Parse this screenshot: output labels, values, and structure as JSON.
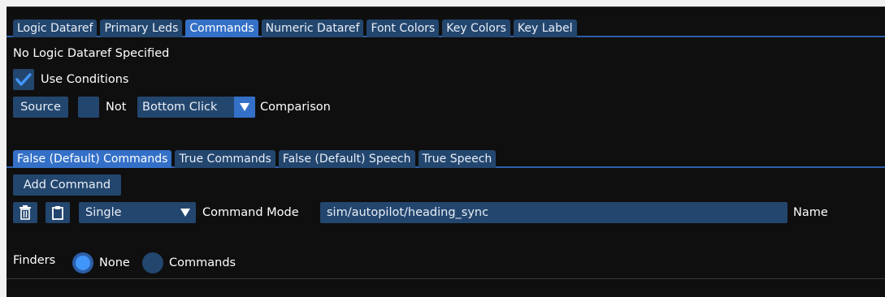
{
  "top_tabs": [
    {
      "label": "Logic Dataref",
      "active": false
    },
    {
      "label": "Primary Leds",
      "active": false
    },
    {
      "label": "Commands",
      "active": true
    },
    {
      "label": "Numeric Dataref",
      "active": false
    },
    {
      "label": "Font Colors",
      "active": false
    },
    {
      "label": "Key Colors",
      "active": false
    },
    {
      "label": "Key Label",
      "active": false
    }
  ],
  "status_text": "No Logic Dataref Specified",
  "use_conditions": {
    "label": "Use Conditions",
    "checked": true
  },
  "condition_row": {
    "source_label": "Source",
    "not_label": "Not",
    "not_checked": false,
    "comparison_value": "Bottom Click",
    "comparison_label": "Comparison"
  },
  "sub_tabs": [
    {
      "label": "False (Default) Commands",
      "active": true
    },
    {
      "label": "True Commands",
      "active": false
    },
    {
      "label": "False (Default) Speech",
      "active": false
    },
    {
      "label": "True Speech",
      "active": false
    }
  ],
  "add_command_label": "Add Command",
  "command_row": {
    "delete_icon": "trash-icon",
    "paste_icon": "clipboard-icon",
    "mode_value": "Single",
    "mode_label": "Command Mode",
    "command_value": "sim/autopilot/heading_sync",
    "name_label": "Name"
  },
  "finders": {
    "label": "Finders",
    "options": [
      {
        "label": "None",
        "selected": true
      },
      {
        "label": "Commands",
        "selected": false
      }
    ]
  },
  "colors": {
    "tab_active": "#3470c7",
    "tab_inactive": "#23466e",
    "frame": "#23466e",
    "radio_selected": "#4296fa",
    "background": "#0f0f0f"
  }
}
